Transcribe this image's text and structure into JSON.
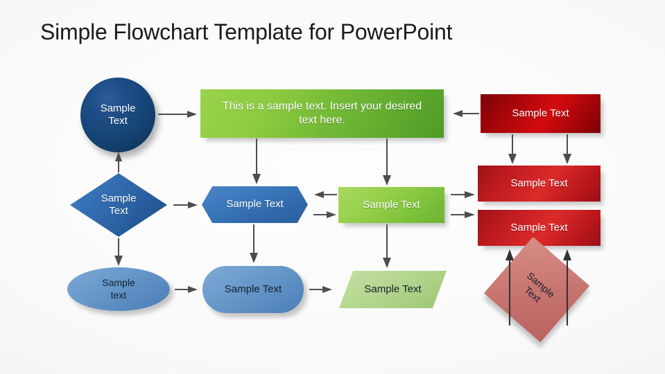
{
  "slide": {
    "title": "Simple Flowchart Template for PowerPoint",
    "background_color": "#fafafa"
  },
  "palette": {
    "circle_blue_dark": "#154576",
    "diamond_blue": "#2f69ab",
    "hexagon_blue": "#3c78bb",
    "ellipse_blue_light": "#6b9ccd",
    "stadium_blue_light": "#6c9dcd",
    "green_bright": "#8ccb3f",
    "green_mid": "#95cf4b",
    "green_pale": "#b8d994",
    "red_dark": "#a00509",
    "red_mid": "#c01c20",
    "red_salmon": "#cf7f79",
    "arrow_gray": "#4d4d4d",
    "text_light": "#ffffff",
    "text_dark": "#16202b"
  },
  "shapes": {
    "circle_start": {
      "label": "Sample\nText",
      "line1": "Sample",
      "line2": "Text",
      "type": "circle",
      "color": "#154576"
    },
    "green_main": {
      "label": "This is a sample text. Insert your desired text here.",
      "type": "rectangle",
      "color": "#8ccb3f"
    },
    "red_dark": {
      "label": "Sample Text",
      "type": "rectangle",
      "color": "#a00509"
    },
    "diamond_decision": {
      "line1": "Sample",
      "line2": "Text",
      "type": "diamond",
      "color": "#2f69ab"
    },
    "hexagon_mid": {
      "label": "Sample Text",
      "type": "hexagon",
      "color": "#3c78bb"
    },
    "green_mid": {
      "label": "Sample Text",
      "type": "rectangle",
      "color": "#95cf4b"
    },
    "red_mid_a": {
      "label": "Sample Text",
      "type": "rectangle",
      "color": "#c01c20"
    },
    "red_mid_b": {
      "label": "Sample Text",
      "type": "rectangle",
      "color": "#c01c20"
    },
    "ellipse_end": {
      "line1": "Sample",
      "line2": "text",
      "type": "ellipse",
      "color": "#6b9ccd"
    },
    "round_mid": {
      "label": "Sample Text",
      "type": "rounded-rectangle",
      "color": "#6c9dcd"
    },
    "parallelogram_data": {
      "label": "Sample Text",
      "type": "parallelogram",
      "color": "#b8d994"
    },
    "square_rot": {
      "line1": "Sample",
      "line2": "Text",
      "type": "rotated-square",
      "color": "#cf7f79"
    }
  },
  "connectors": [
    {
      "name": "circle-to-green",
      "from": "circle_start",
      "to": "green_main",
      "direction": "right"
    },
    {
      "name": "diamond-to-circle",
      "from": "diamond_decision",
      "to": "circle_start",
      "direction": "up"
    },
    {
      "name": "green-to-hexagon",
      "from": "green_main",
      "to": "hexagon_mid",
      "direction": "down"
    },
    {
      "name": "green-to-greenmid",
      "from": "green_main",
      "to": "green_mid",
      "direction": "down"
    },
    {
      "name": "reddark-to-green",
      "from": "red_dark",
      "to": "green_main",
      "direction": "left"
    },
    {
      "name": "reddark-to-redmid-a",
      "from": "red_dark",
      "to": "red_mid_a",
      "direction": "down"
    },
    {
      "name": "reddark-to-redmid-b",
      "from": "red_dark",
      "to": "red_mid_a",
      "direction": "down"
    },
    {
      "name": "diamond-to-hexagon",
      "from": "diamond_decision",
      "to": "hexagon_mid",
      "direction": "right"
    },
    {
      "name": "greenmid-to-hexagon",
      "from": "green_mid",
      "to": "hexagon_mid",
      "direction": "left"
    },
    {
      "name": "hexagon-to-greenmid",
      "from": "hexagon_mid",
      "to": "green_mid",
      "direction": "right"
    },
    {
      "name": "greenmid-to-redmid-a",
      "from": "green_mid",
      "to": "red_mid_a",
      "direction": "right"
    },
    {
      "name": "greenmid-to-redmid-b",
      "from": "green_mid",
      "to": "red_mid_b",
      "direction": "right"
    },
    {
      "name": "diamond-to-ellipse",
      "from": "diamond_decision",
      "to": "ellipse_end",
      "direction": "down"
    },
    {
      "name": "hexagon-to-round",
      "from": "hexagon_mid",
      "to": "round_mid",
      "direction": "down"
    },
    {
      "name": "greenmid-to-parallelogram",
      "from": "green_mid",
      "to": "parallelogram_data",
      "direction": "down"
    },
    {
      "name": "ellipse-to-round",
      "from": "ellipse_end",
      "to": "round_mid",
      "direction": "right"
    },
    {
      "name": "round-to-parallelogram",
      "from": "round_mid",
      "to": "parallelogram_data",
      "direction": "right"
    },
    {
      "name": "square-to-redmid-left",
      "from": "square_rot",
      "to": "red_mid_b",
      "direction": "up"
    },
    {
      "name": "square-to-redmid-right",
      "from": "square_rot",
      "to": "red_mid_b",
      "direction": "up"
    }
  ]
}
